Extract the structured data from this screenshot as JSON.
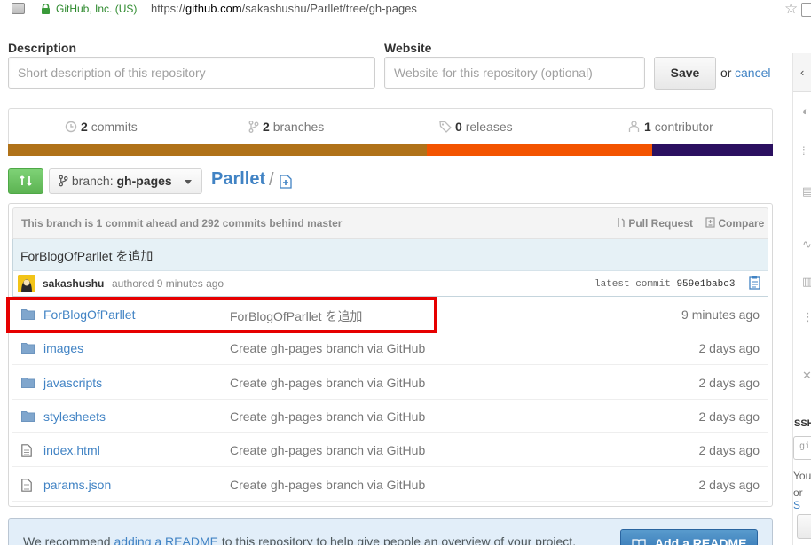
{
  "browser": {
    "secure_label": "GitHub, Inc. (US)",
    "url_prefix": "https://",
    "url_host": "github.com",
    "url_path": "/sakashushu/Parllet/tree/gh-pages"
  },
  "form": {
    "description_label": "Description",
    "description_placeholder": "Short description of this repository",
    "website_label": "Website",
    "website_placeholder": "Website for this repository (optional)",
    "save_label": "Save",
    "or_text": "or",
    "cancel_label": "cancel"
  },
  "summary": {
    "commits_count": "2",
    "commits_label": "commits",
    "branches_count": "2",
    "branches_label": "branches",
    "releases_count": "0",
    "releases_label": "releases",
    "contributors_count": "1",
    "contributors_label": "contributor"
  },
  "language_bar": [
    {
      "color": "#b07219",
      "fraction": 0.547
    },
    {
      "color": "#f35400",
      "fraction": 0.295
    },
    {
      "color": "#2b1060",
      "fraction": 0.158
    }
  ],
  "branch": {
    "prefix": "branch:",
    "name": "gh-pages"
  },
  "repo": {
    "name": "Parllet",
    "slash": "/"
  },
  "ahead_behind": {
    "text": "This branch is 1 commit ahead and 292 commits behind master",
    "pull_request_label": "Pull Request",
    "compare_label": "Compare"
  },
  "commit": {
    "title": "ForBlogOfParllet を追加",
    "author": "sakashushu",
    "authored": "authored 9 minutes ago",
    "latest_label": "latest commit",
    "sha": "959e1babc3"
  },
  "files": [
    {
      "type": "folder",
      "name": "ForBlogOfParllet",
      "message": "ForBlogOfParllet を追加",
      "age": "9 minutes ago"
    },
    {
      "type": "folder",
      "name": "images",
      "message": "Create gh-pages branch via GitHub",
      "age": "2 days ago"
    },
    {
      "type": "folder",
      "name": "javascripts",
      "message": "Create gh-pages branch via GitHub",
      "age": "2 days ago"
    },
    {
      "type": "folder",
      "name": "stylesheets",
      "message": "Create gh-pages branch via GitHub",
      "age": "2 days ago"
    },
    {
      "type": "file",
      "name": "index.html",
      "message": "Create gh-pages branch via GitHub",
      "age": "2 days ago"
    },
    {
      "type": "file",
      "name": "params.json",
      "message": "Create gh-pages branch via GitHub",
      "age": "2 days ago"
    }
  ],
  "readme": {
    "text_before": "We recommend",
    "link": "adding a README",
    "text_after": "to this repository to help give people an overview of your project.",
    "button_label": "Add a README"
  },
  "sidebar": {
    "ssh_label": "SSH",
    "clone_value": "gi",
    "you_text": "You",
    "or_text": "or",
    "s_link": "S"
  },
  "colors": {
    "link": "#4183c4",
    "highlight": "#e60000",
    "compare_green": "#6cc644"
  }
}
